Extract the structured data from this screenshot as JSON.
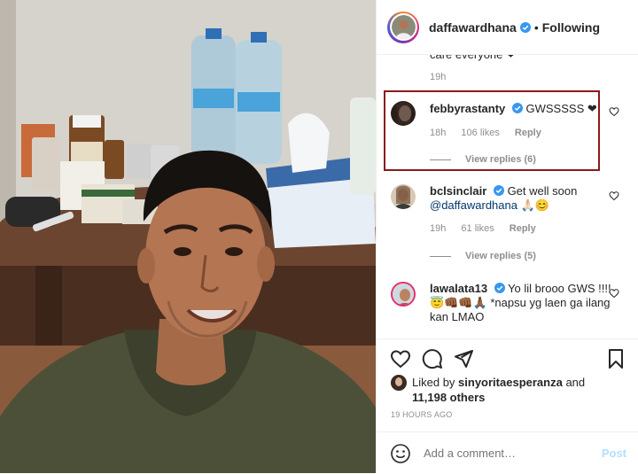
{
  "header": {
    "username": "daffawardhana",
    "separator": "•",
    "follow_status": "Following"
  },
  "previous_comment": {
    "text_fragment": "care everyone ❤",
    "time": "19h"
  },
  "comments": [
    {
      "username": "febbyrastanty",
      "text": "GWSSSSS ❤",
      "time": "18h",
      "likes": "106 likes",
      "reply_label": "Reply",
      "view_replies": "View replies (6)",
      "highlighted": true
    },
    {
      "username": "bclsinclair",
      "text": "Get well soon",
      "mention": "@daffawardhana",
      "emoji": "🙏🏻😊",
      "time": "19h",
      "likes": "61 likes",
      "reply_label": "Reply",
      "view_replies": "View replies (5)"
    },
    {
      "username": "lawalata13",
      "text": "Yo lil brooo GWS !!!! 😇👊🏾👊🏾🙏🏾 *napsu yg laen ga ilang kan LMAO"
    }
  ],
  "likes": {
    "prefix": "Liked by",
    "user": "sinyoritaesperanza",
    "and": "and",
    "others": "11,198 others"
  },
  "time_ago": "19 HOURS AGO",
  "add_comment": {
    "placeholder": "Add a comment…",
    "post_label": "Post"
  },
  "colors": {
    "verified_blue": "#3897f0",
    "highlight_border": "#8b1a1a",
    "heart_red": "#ed4956",
    "post_disabled": "#b2dffc"
  }
}
